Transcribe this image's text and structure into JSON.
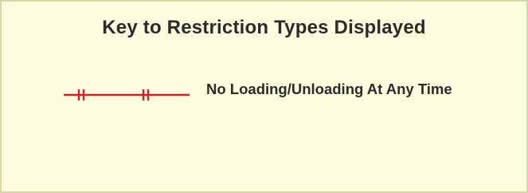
{
  "legend": {
    "title": "Key to Restriction Types Displayed",
    "items": [
      {
        "label": "No Loading/Unloading At Any Time",
        "symbol": "red-line-double-ticks-icon",
        "color": "#d0202e"
      }
    ]
  },
  "colors": {
    "background": "#fcfcdf",
    "border": "#d8d6a8",
    "text": "#2b2b2b",
    "restriction_line": "#d0202e"
  }
}
